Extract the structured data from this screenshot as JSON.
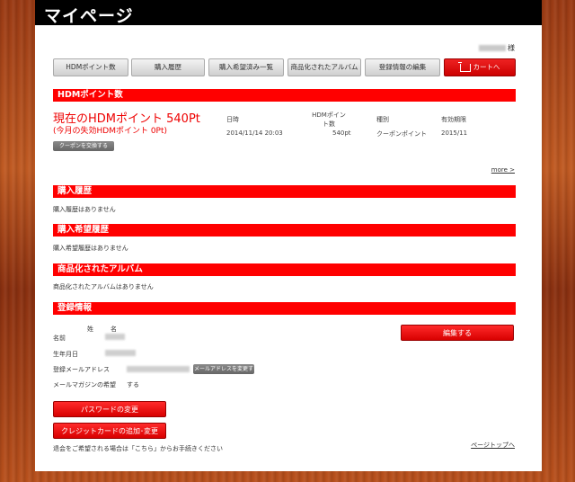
{
  "header": {
    "title": "マイページ"
  },
  "user": {
    "suffix": "様"
  },
  "tabs": [
    {
      "label": "HDMポイント数"
    },
    {
      "label": "購入履歴"
    },
    {
      "label": "購入希望済み一覧"
    },
    {
      "label": "商品化されたアルバム"
    },
    {
      "label": "登録情報の編集"
    },
    {
      "label": "カートへ",
      "icon": "cart-icon"
    }
  ],
  "points": {
    "heading": "HDMポイント数",
    "current": "現在のHDMポイント 540Pt",
    "expiring": "(今月の失効HDMポイント 0Pt)",
    "coupon_button": "クーポンを交換する",
    "columns": {
      "date": "日時",
      "points": "HDMポイント数",
      "type": "種別",
      "expiry": "有効期限"
    },
    "row": {
      "date": "2014/11/14 20:03",
      "points": "540pt",
      "type": "クーポンポイント",
      "expiry": "2015/11"
    },
    "more": "more >"
  },
  "purchase_history": {
    "heading": "購入履歴",
    "empty": "購入履歴はありません"
  },
  "wishlist": {
    "heading": "購入希望履歴",
    "empty": "購入希望履歴はありません"
  },
  "albums": {
    "heading": "商品化されたアルバム",
    "empty": "商品化されたアルバムはありません"
  },
  "registration": {
    "heading": "登録情報",
    "name_header_last": "姓",
    "name_header_first": "名",
    "name_label": "名前",
    "birthday_label": "生年月日",
    "email_label": "登録メールアドレス",
    "change_email_button": "メールアドレスを変更する",
    "newsletter_label": "メールマガジンの希望",
    "newsletter_value": "する",
    "edit_button": "編集する",
    "password_button": "パスワードの変更",
    "card_button": "クレジットカードの追加･変更",
    "withdraw_note": "退会をご希望される場合は「こちら」からお手続きください",
    "page_top": "ページトップへ"
  },
  "colors": {
    "accent": "#ff0000",
    "header_bg": "#000000"
  }
}
